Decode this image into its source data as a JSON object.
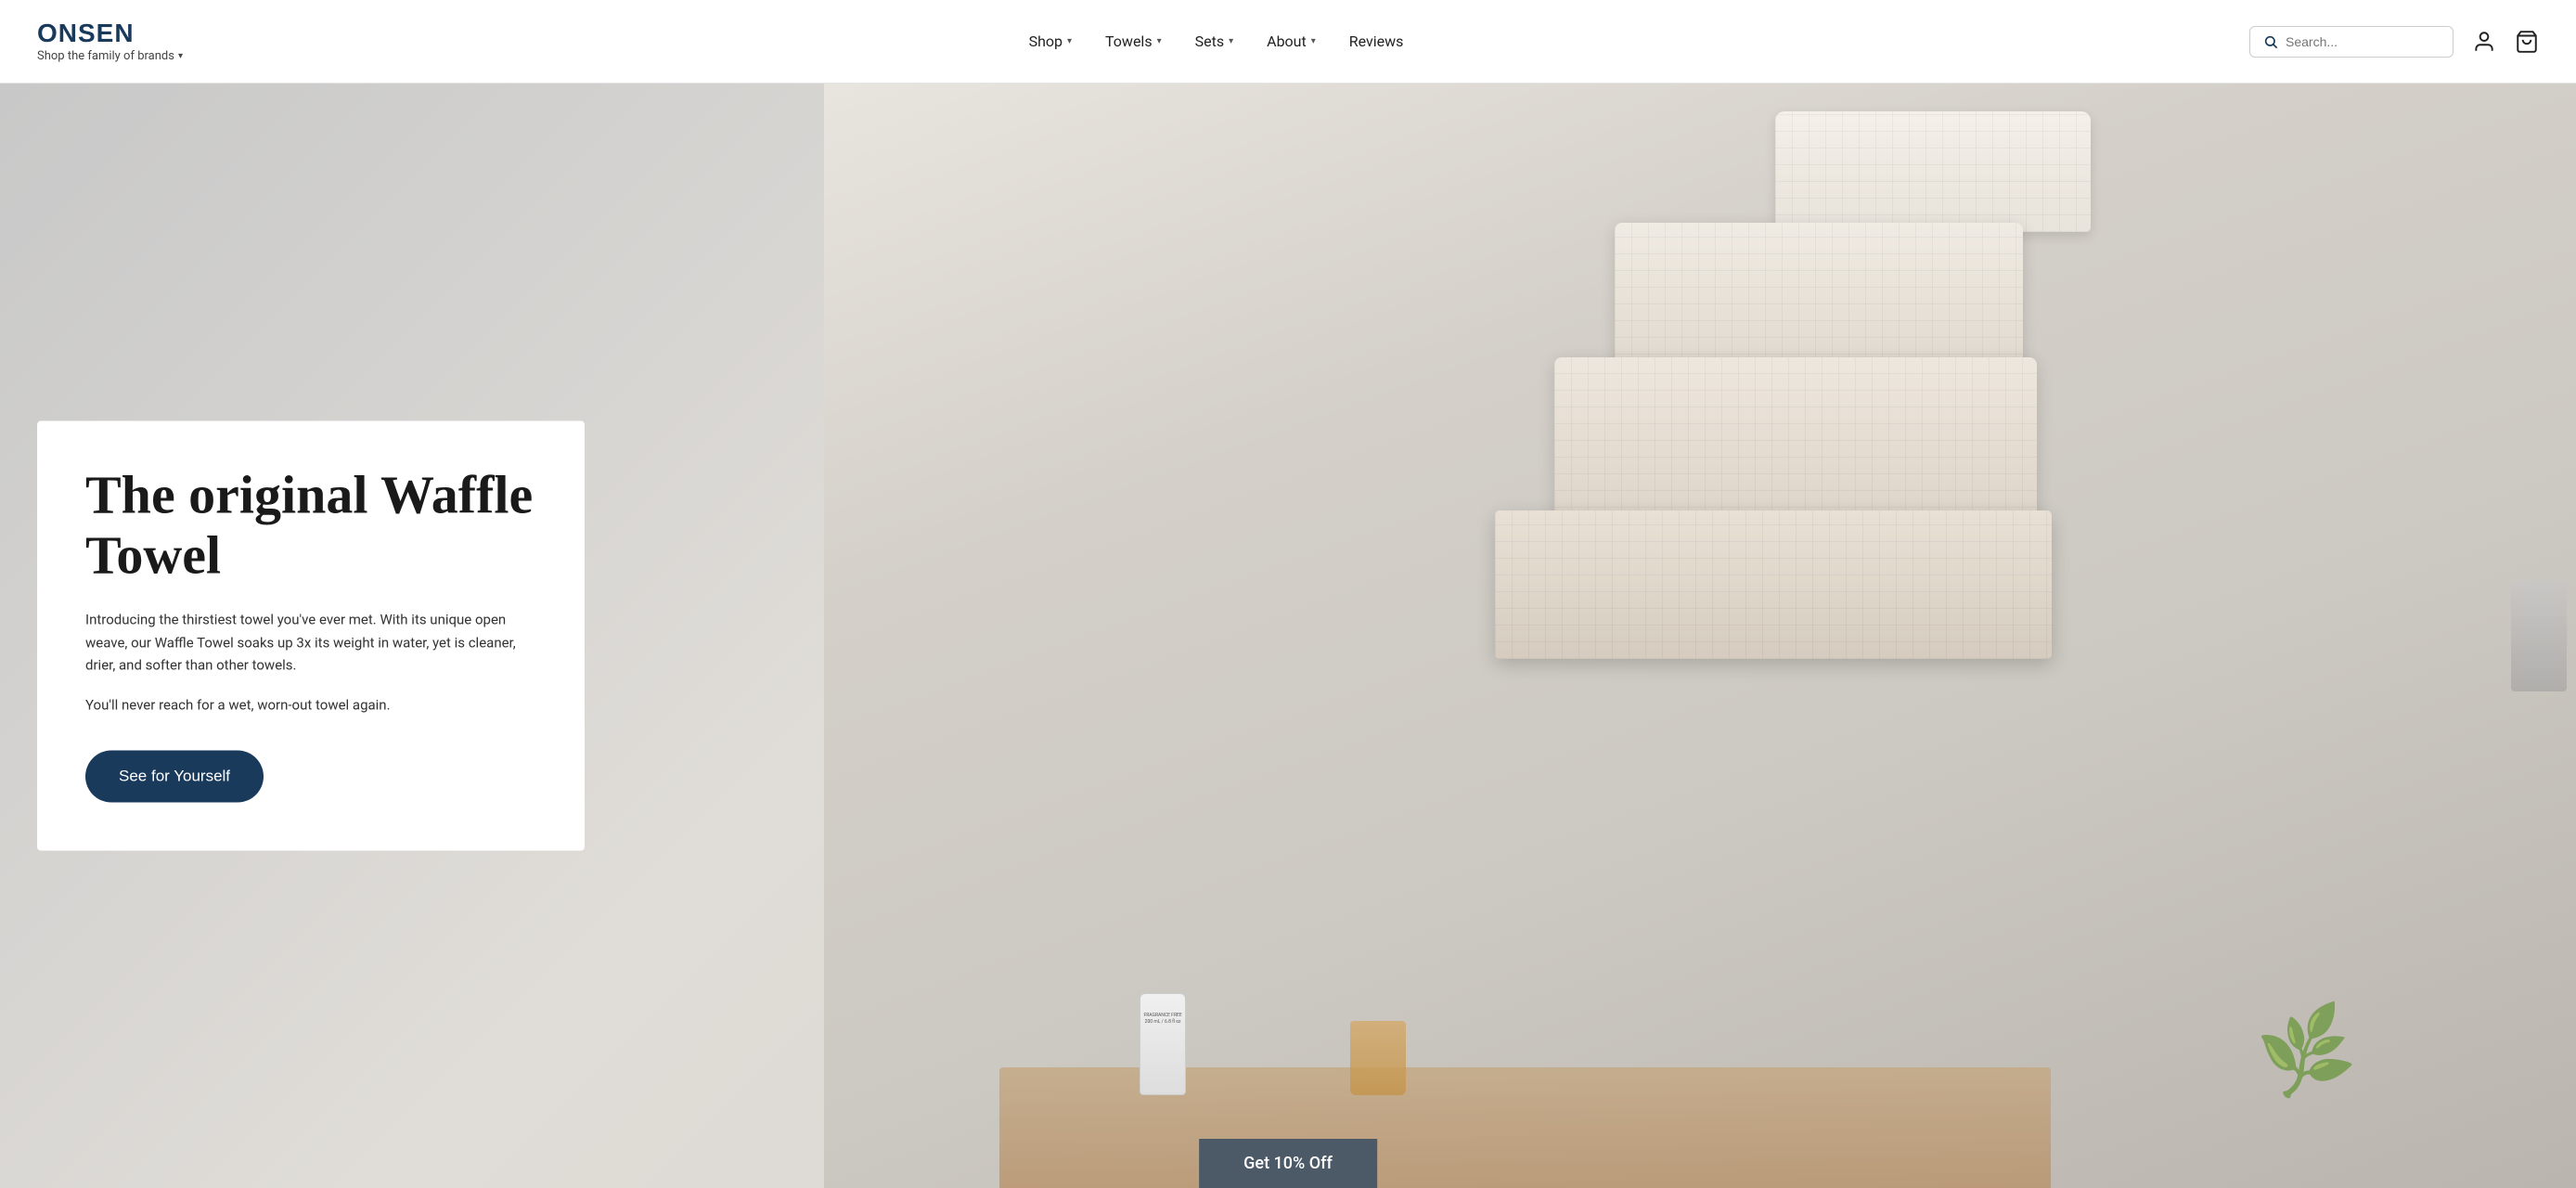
{
  "brand": {
    "logo": "ONSEN",
    "sub_text": "Shop the family of brands",
    "sub_chevron": "▾"
  },
  "nav": {
    "items": [
      {
        "label": "Shop",
        "has_dropdown": true
      },
      {
        "label": "Towels",
        "has_dropdown": true
      },
      {
        "label": "Sets",
        "has_dropdown": true
      },
      {
        "label": "About",
        "has_dropdown": true
      },
      {
        "label": "Reviews",
        "has_dropdown": false
      }
    ]
  },
  "search": {
    "placeholder": "Search..."
  },
  "hero": {
    "title": "The original Waffle Towel",
    "desc1": "Introducing the thirstiest towel you've ever met. With its unique open weave, our Waffle Towel soaks up 3x its weight in water, yet is cleaner, drier, and softer than other towels.",
    "desc2": "You'll never reach for a wet, worn-out towel again.",
    "cta_label": "See for Yourself"
  },
  "discount": {
    "label": "Get 10% Off"
  },
  "icons": {
    "search": "🔍",
    "user": "👤",
    "cart": "🛒",
    "chevron_down": "▾"
  }
}
